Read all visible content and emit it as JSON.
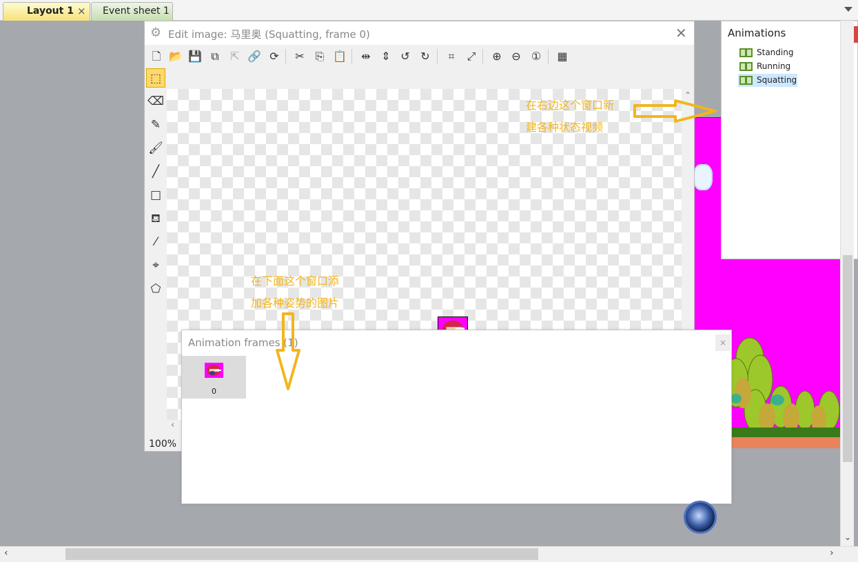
{
  "tabs": {
    "layout": "Layout 1",
    "layout_close": "×",
    "event": "Event sheet 1"
  },
  "editor": {
    "title": "Edit image: 马里奥 (Squatting, frame 0)",
    "close": "✕",
    "zoom": "100%"
  },
  "animations_panel": {
    "title": "Animations",
    "close": "×",
    "items": [
      "Standing",
      "Running",
      "Squatting"
    ],
    "selected": "Squatting"
  },
  "frames_panel": {
    "title": "Animation frames (1)",
    "close": "×",
    "frames": [
      {
        "label": "0"
      }
    ]
  },
  "annotations": {
    "right_line1": "在右边这个窗口新",
    "right_line2": "建各种状态视频",
    "bottom_line1": "在下面这个窗口添",
    "bottom_line2": "加各种姿势的图片"
  },
  "colors": {
    "annotation": "#f2b51e",
    "layout_tab": "#f6e27a",
    "event_tab": "#c6ddb0",
    "magenta": "#ff00ff",
    "close_red": "#d64545",
    "selected": "#cde8ff"
  },
  "icons": {
    "toolbar": [
      "new-icon",
      "open-icon",
      "save-icon",
      "save-all-icon",
      "export-icon",
      "link-icon",
      "refresh-icon",
      "cut-icon",
      "copy-icon",
      "paste-icon",
      "flip-horizontal-icon",
      "flip-vertical-icon",
      "rotate-left-icon",
      "rotate-right-icon",
      "crop-icon",
      "resize-icon",
      "zoom-in-icon",
      "zoom-out-icon",
      "zoom-reset-icon",
      "transparency-icon"
    ],
    "side": [
      "select-icon",
      "eraser-icon",
      "pencil-icon",
      "brush-icon",
      "line-icon",
      "rectangle-icon",
      "fill-icon",
      "picker-icon",
      "origin-icon",
      "polygon-icon"
    ]
  }
}
